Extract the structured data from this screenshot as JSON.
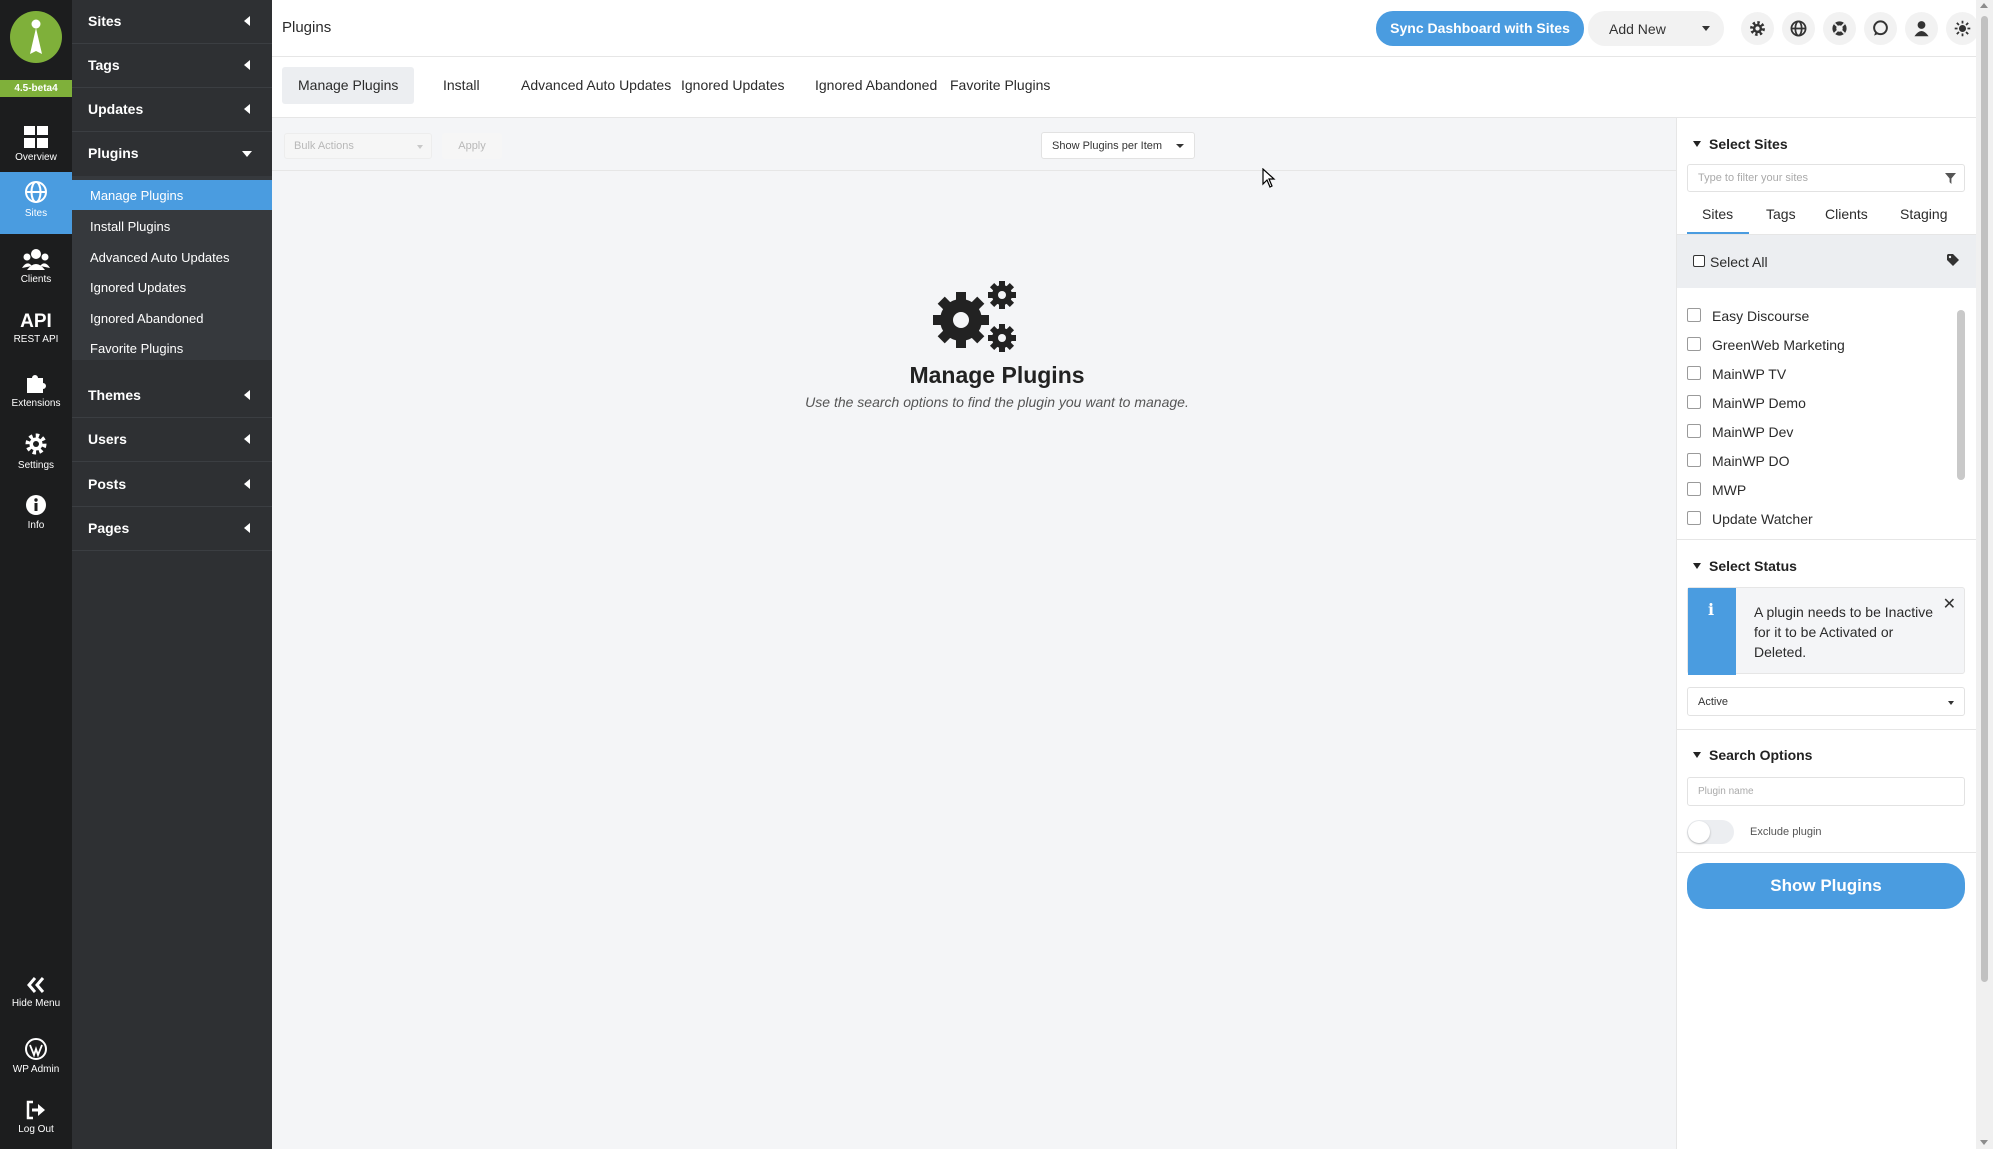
{
  "app": {
    "version_badge": "4.5-beta4"
  },
  "rail": {
    "overview": "Overview",
    "sites": "Sites",
    "clients": "Clients",
    "api_mark": "API",
    "rest_api": "REST API",
    "extensions": "Extensions",
    "settings": "Settings",
    "info": "Info",
    "hide_menu": "Hide Menu",
    "wp_admin": "WP Admin",
    "log_out": "Log Out"
  },
  "menu": {
    "sites": "Sites",
    "tags": "Tags",
    "updates": "Updates",
    "plugins": "Plugins",
    "plugins_sub": [
      "Manage Plugins",
      "Install Plugins",
      "Advanced Auto Updates",
      "Ignored Updates",
      "Ignored Abandoned",
      "Favorite Plugins"
    ],
    "themes": "Themes",
    "users": "Users",
    "posts": "Posts",
    "pages": "Pages"
  },
  "header": {
    "title": "Plugins",
    "sync_label": "Sync Dashboard with Sites",
    "add_new_label": "Add New"
  },
  "tabs": [
    "Manage Plugins",
    "Install",
    "Advanced Auto Updates",
    "Ignored Updates",
    "Ignored Abandoned",
    "Favorite Plugins"
  ],
  "toolbar": {
    "bulk_actions": "Bulk Actions",
    "apply": "Apply",
    "per_page": "Show Plugins per Item"
  },
  "empty_state": {
    "title": "Manage Plugins",
    "description": "Use the search options to find the plugin you want to manage."
  },
  "panel": {
    "select_sites": "Select Sites",
    "filter_placeholder": "Type to filter your sites",
    "tabs": [
      "Sites",
      "Tags",
      "Clients",
      "Staging"
    ],
    "select_all": "Select All",
    "sites": [
      "Easy Discourse",
      "GreenWeb Marketing",
      "MainWP TV",
      "MainWP Demo",
      "MainWP Dev",
      "MainWP DO",
      "MWP",
      "Update Watcher"
    ],
    "select_status": "Select Status",
    "info_message": "A plugin needs to be Inactive for it to be Activated or Deleted.",
    "status_value": "Active",
    "search_options": "Search Options",
    "plugin_name_placeholder": "Plugin name",
    "exclude_label": "Exclude plugin",
    "exclude_enabled": false,
    "show_button": "Show Plugins"
  },
  "colors": {
    "accent": "#4a9ce0",
    "brand": "#7fb03a",
    "rail": "#1c1d1e",
    "menu": "#2e3033"
  }
}
